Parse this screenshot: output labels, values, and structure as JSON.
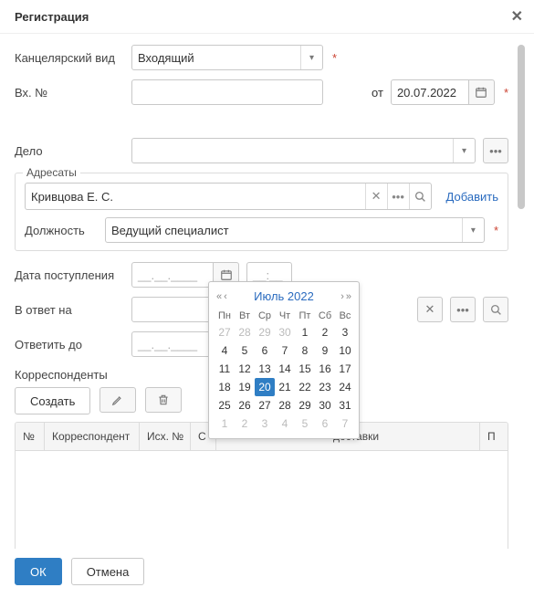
{
  "dialog": {
    "title": "Регистрация"
  },
  "form": {
    "kanc_label": "Канцелярский вид",
    "kanc_value": "Входящий",
    "vhno_label": "Вх. №",
    "ot_label": "от",
    "ot_date": "20.07.2022",
    "delo_label": "Дело",
    "addressees_legend": "Адресаты",
    "addressee_name": "Кривцова Е. С.",
    "add_link": "Добавить",
    "position_label": "Должность",
    "position_value": "Ведущий специалист",
    "receipt_date_label": "Дата поступления",
    "date_placeholder": "__.__.____",
    "time_placeholder": "__:__",
    "reply_to_label": "В ответ на",
    "reply_by_label": "Ответить до",
    "correspondents_title": "Корреспонденты",
    "create_btn": "Создать"
  },
  "table": {
    "cols": [
      "№",
      "Корреспондент",
      "Исх. №",
      "С",
      "доставки",
      "П"
    ]
  },
  "calendar": {
    "title": "Июль 2022",
    "dow": [
      "Пн",
      "Вт",
      "Ср",
      "Чт",
      "Пт",
      "Сб",
      "Вс"
    ],
    "prev_tail": [
      27,
      28,
      29,
      30
    ],
    "days": [
      1,
      2,
      3,
      4,
      5,
      6,
      7,
      8,
      9,
      10,
      11,
      12,
      13,
      14,
      15,
      16,
      17,
      18,
      19,
      20,
      21,
      22,
      23,
      24,
      25,
      26,
      27,
      28,
      29,
      30,
      31
    ],
    "next_head": [
      1,
      2,
      3,
      4,
      5,
      6,
      7
    ],
    "selected": 20
  },
  "footer": {
    "ok": "ОК",
    "cancel": "Отмена"
  }
}
